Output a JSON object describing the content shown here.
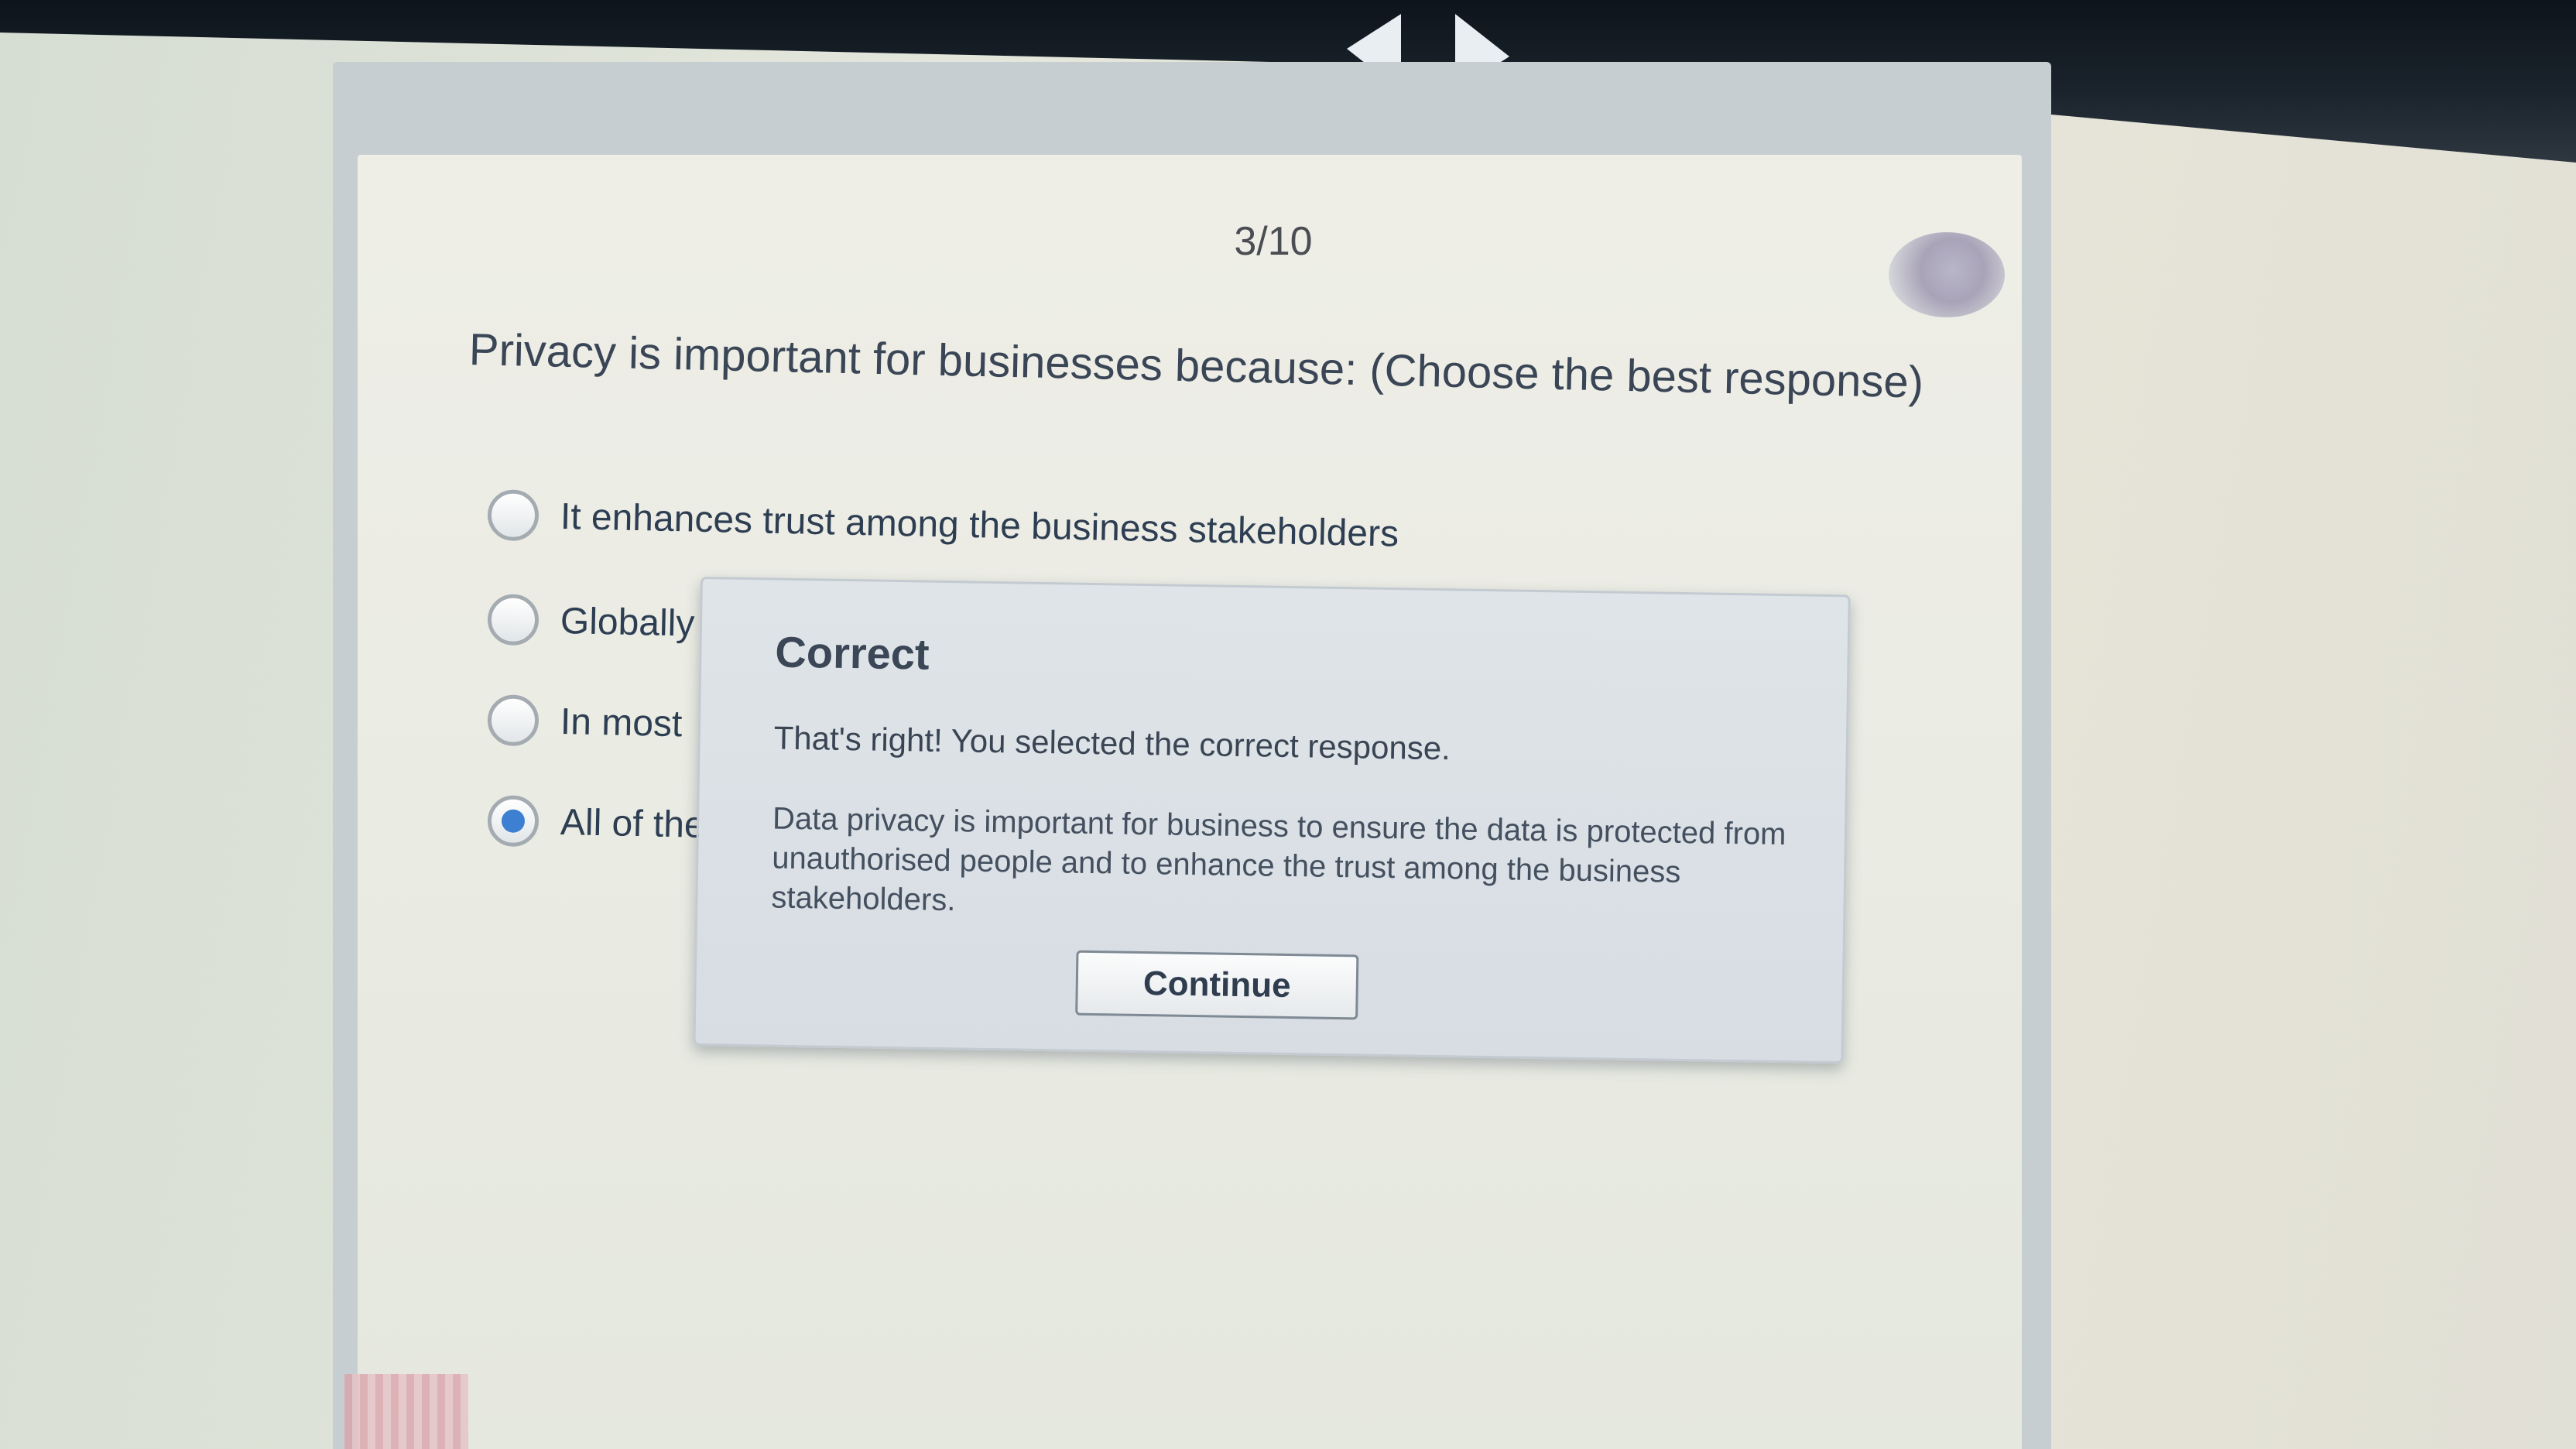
{
  "navigation": {
    "prev_icon": "arrow-left-icon",
    "next_icon": "arrow-right-icon"
  },
  "quiz": {
    "progress": "3/10",
    "question": "Privacy is important for businesses because: (Choose the best response)",
    "options": [
      {
        "label": "It enhances trust among the business stakeholders",
        "selected": false
      },
      {
        "label": "Globally",
        "selected": false
      },
      {
        "label": "In most",
        "selected": false
      },
      {
        "label": "All of the",
        "selected": true
      }
    ]
  },
  "feedback": {
    "title": "Correct",
    "message": "That's right!  You selected the correct response.",
    "explanation": "Data privacy is important for business to ensure the data is protected from unauthorised people and to enhance the trust among the business stakeholders.",
    "continue_label": "Continue"
  },
  "colors": {
    "selected_radio": "#3d7fd0",
    "dialog_background": "#dfe4e8"
  }
}
